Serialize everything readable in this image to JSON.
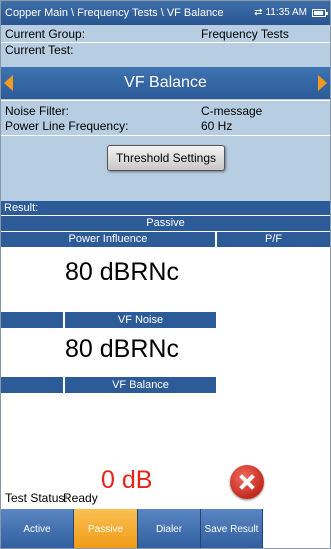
{
  "header": {
    "breadcrumb": "Copper Main \\ Frequency Tests \\ VF Balance",
    "time": "11:35 AM"
  },
  "info": {
    "current_group_label": "Current Group:",
    "current_group_value": "Frequency Tests",
    "current_test_label": "Current Test:",
    "current_test_value": "VF Balance",
    "noise_filter_label": "Noise Filter:",
    "noise_filter_value": "C-message",
    "power_line_freq_label": "Power Line Frequency:",
    "power_line_freq_value": "60 Hz",
    "threshold_button": "Threshold Settings"
  },
  "results": {
    "result_label": "Result:",
    "mode_label": "Passive",
    "power_influence_header": "Power Influence",
    "pf_header": "P/F",
    "power_influence_value": "80 dBRNc",
    "vf_noise_header": "VF Noise",
    "vf_noise_value": "80 dBRNc",
    "vf_balance_header": "VF Balance",
    "vf_balance_value": "0 dB",
    "vf_balance_color": "#e8241a"
  },
  "status": {
    "label": "Test Status:",
    "value": "Ready"
  },
  "tabs": [
    {
      "label": "Active"
    },
    {
      "label": "Passive"
    },
    {
      "label": "Dialer"
    },
    {
      "label": "Save Result"
    }
  ],
  "colors": {
    "accent": "#2d5b98",
    "info_bg": "#b7cde2",
    "active_tab": "#f09a14"
  }
}
